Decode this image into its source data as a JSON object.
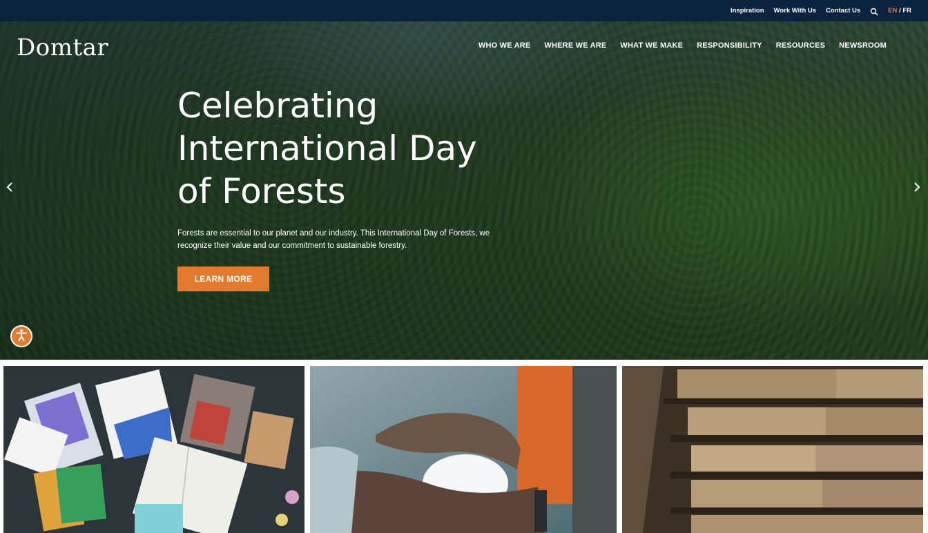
{
  "utility_nav": {
    "links": [
      "Inspiration",
      "Work With Us",
      "Contact Us"
    ],
    "lang_en": "EN",
    "lang_sep": " / ",
    "lang_fr": "FR"
  },
  "brand": {
    "logo_text": "Domtar"
  },
  "main_nav": {
    "items": [
      "WHO WE ARE",
      "WHERE WE ARE",
      "WHAT WE MAKE",
      "RESPONSIBILITY",
      "RESOURCES",
      "NEWSROOM"
    ]
  },
  "hero": {
    "title_lines": [
      "Celebrating",
      "International Day",
      "of Forests"
    ],
    "description_lines": [
      "Forests are essential to our planet and our industry. This International Day of Forests, we",
      "recognize their value and our commitment to sustainable forestry."
    ],
    "cta_label": "LEARN MORE"
  },
  "icons": {
    "search": "search-icon",
    "prev": "chevron-left-icon",
    "next": "chevron-right-icon",
    "accessibility": "accessibility-icon"
  },
  "colors": {
    "navy": "#0c2340",
    "accent_orange": "#e47a2e",
    "white": "#ffffff"
  }
}
